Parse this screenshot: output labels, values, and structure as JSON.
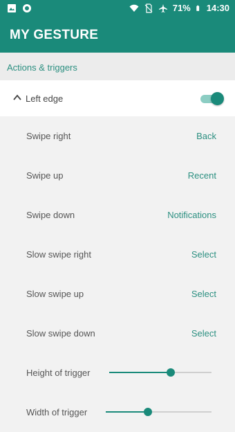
{
  "status_bar": {
    "battery_percent": "71%",
    "time": "14:30",
    "icons": [
      "image-icon",
      "circle-notification-icon",
      "wifi-icon",
      "no-sim-icon",
      "airplane-icon",
      "battery-icon"
    ]
  },
  "app_bar": {
    "title": "MY GESTURE"
  },
  "section": {
    "header": "Actions & triggers"
  },
  "group": {
    "label": "Left edge",
    "toggle_on": true
  },
  "items": [
    {
      "label": "Swipe right",
      "value": "Back"
    },
    {
      "label": "Swipe up",
      "value": "Recent"
    },
    {
      "label": "Swipe down",
      "value": "Notifications"
    },
    {
      "label": "Slow swipe right",
      "value": "Select"
    },
    {
      "label": "Slow swipe up",
      "value": "Select"
    },
    {
      "label": "Slow swipe down",
      "value": "Select"
    }
  ],
  "sliders": [
    {
      "label": "Height of trigger",
      "level": 0.6
    },
    {
      "label": "Width of trigger",
      "level": 0.4
    }
  ],
  "colors": {
    "accent": "#1a8a7a",
    "accent_text": "#2b8f80"
  }
}
